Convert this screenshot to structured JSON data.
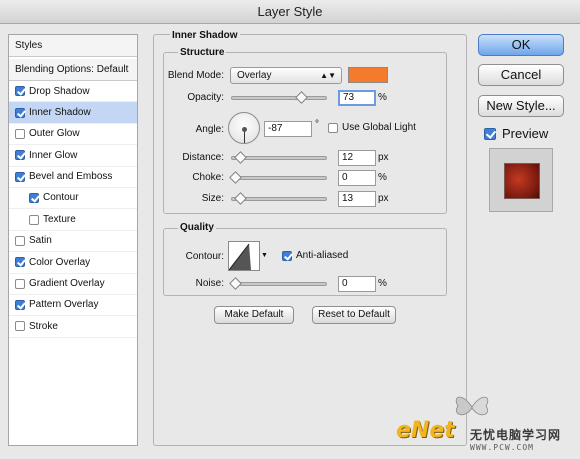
{
  "window": {
    "title": "Layer Style"
  },
  "left_panel": {
    "header": "Styles",
    "blending": "Blending Options: Default",
    "items": [
      {
        "label": "Drop Shadow",
        "checked": true,
        "selected": false,
        "sub": false
      },
      {
        "label": "Inner Shadow",
        "checked": true,
        "selected": true,
        "sub": false
      },
      {
        "label": "Outer Glow",
        "checked": false,
        "selected": false,
        "sub": false
      },
      {
        "label": "Inner Glow",
        "checked": true,
        "selected": false,
        "sub": false
      },
      {
        "label": "Bevel and Emboss",
        "checked": true,
        "selected": false,
        "sub": false
      },
      {
        "label": "Contour",
        "checked": true,
        "selected": false,
        "sub": true
      },
      {
        "label": "Texture",
        "checked": false,
        "selected": false,
        "sub": true
      },
      {
        "label": "Satin",
        "checked": false,
        "selected": false,
        "sub": false
      },
      {
        "label": "Color Overlay",
        "checked": true,
        "selected": false,
        "sub": false
      },
      {
        "label": "Gradient Overlay",
        "checked": false,
        "selected": false,
        "sub": false
      },
      {
        "label": "Pattern Overlay",
        "checked": true,
        "selected": false,
        "sub": false
      },
      {
        "label": "Stroke",
        "checked": false,
        "selected": false,
        "sub": false
      }
    ]
  },
  "inner_shadow": {
    "title": "Inner Shadow",
    "structure": {
      "title": "Structure",
      "blend_mode_label": "Blend Mode:",
      "blend_mode_value": "Overlay",
      "shadow_color": "#f47a2c",
      "opacity_label": "Opacity:",
      "opacity_value": "73",
      "opacity_unit": "%",
      "opacity_level": 0.73,
      "angle_label": "Angle:",
      "angle_value": "-87",
      "angle_unit": "°",
      "use_global_light_label": "Use Global Light",
      "use_global_light_checked": false,
      "distance_label": "Distance:",
      "distance_value": "12",
      "distance_unit": "px",
      "distance_level": 0.05,
      "choke_label": "Choke:",
      "choke_value": "0",
      "choke_unit": "%",
      "choke_level": 0.0,
      "size_label": "Size:",
      "size_value": "13",
      "size_unit": "px",
      "size_level": 0.05
    },
    "quality": {
      "title": "Quality",
      "contour_label": "Contour:",
      "anti_aliased_label": "Anti-aliased",
      "anti_aliased_checked": true,
      "noise_label": "Noise:",
      "noise_value": "0",
      "noise_unit": "%",
      "noise_level": 0.0
    },
    "make_default_label": "Make Default",
    "reset_default_label": "Reset to Default"
  },
  "buttons": {
    "ok": "OK",
    "cancel": "Cancel",
    "new_style": "New Style...",
    "preview_label": "Preview",
    "preview_checked": true
  },
  "watermark": {
    "brand": "eNet",
    "chinese": "无忧电脑学习网",
    "url": "WWW.PCW.COM"
  }
}
